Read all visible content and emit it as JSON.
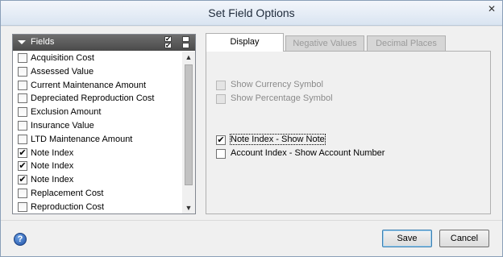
{
  "window": {
    "title": "Set Field Options",
    "close_label": "✕"
  },
  "fields": {
    "header_label": "Fields",
    "items": [
      {
        "label": "Acquisition Cost",
        "checked": false
      },
      {
        "label": "Assessed Value",
        "checked": false
      },
      {
        "label": "Current Maintenance Amount",
        "checked": false
      },
      {
        "label": "Depreciated Reproduction Cost",
        "checked": false
      },
      {
        "label": "Exclusion Amount",
        "checked": false
      },
      {
        "label": "Insurance Value",
        "checked": false
      },
      {
        "label": "LTD Maintenance Amount",
        "checked": false
      },
      {
        "label": "Note Index",
        "checked": true
      },
      {
        "label": "Note Index",
        "checked": true
      },
      {
        "label": "Note Index",
        "checked": true
      },
      {
        "label": "Replacement Cost",
        "checked": false
      },
      {
        "label": "Reproduction Cost",
        "checked": false
      }
    ]
  },
  "tabs": [
    {
      "label": "Display",
      "active": true
    },
    {
      "label": "Negative Values",
      "active": false
    },
    {
      "label": "Decimal Places",
      "active": false
    }
  ],
  "display": {
    "show_currency_symbol": {
      "label": "Show Currency Symbol",
      "checked": false,
      "enabled": false
    },
    "show_percentage_symbol": {
      "label": "Show Percentage Symbol",
      "checked": false,
      "enabled": false
    },
    "note_index_show_note": {
      "label": "Note Index - Show Note",
      "checked": true,
      "enabled": true
    },
    "account_index_show_account_number": {
      "label": "Account Index - Show Account Number",
      "checked": false,
      "enabled": true
    }
  },
  "footer": {
    "help_glyph": "?",
    "save_label": "Save",
    "cancel_label": "Cancel"
  },
  "glyphs": {
    "check": "✔",
    "scroll_up": "▲",
    "scroll_down": "▼"
  }
}
